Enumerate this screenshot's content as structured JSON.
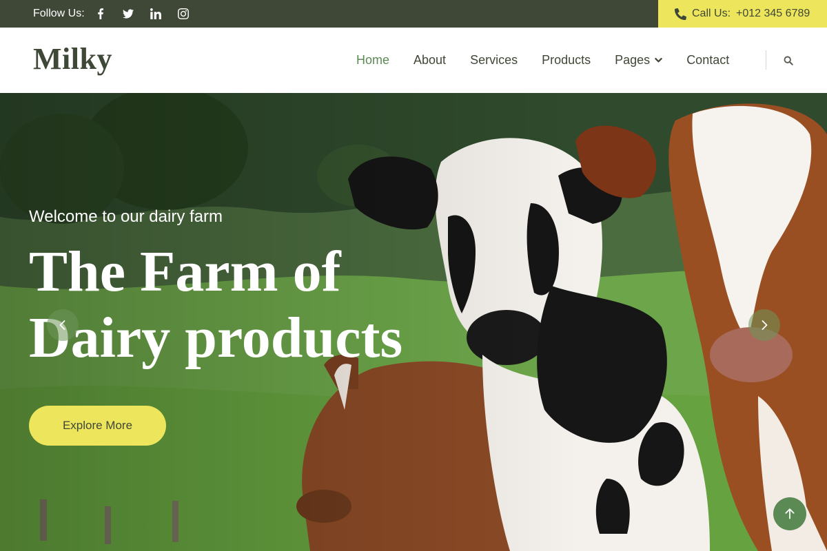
{
  "topbar": {
    "follow_label": "Follow Us:",
    "social_icons": [
      "facebook-icon",
      "twitter-icon",
      "linkedin-icon",
      "instagram-icon"
    ],
    "call_label": "Call Us:",
    "phone": "+012 345 6789",
    "background_color": "#3f4737",
    "call_background_color": "#ede55c"
  },
  "nav": {
    "brand": "Milky",
    "items": [
      {
        "label": "Home",
        "active": true
      },
      {
        "label": "About"
      },
      {
        "label": "Services"
      },
      {
        "label": "Products"
      },
      {
        "label": "Pages",
        "has_dropdown": true
      },
      {
        "label": "Contact"
      }
    ],
    "search_icon": "search-icon",
    "active_color": "#5b8a55"
  },
  "hero": {
    "subtitle": "Welcome to our dairy farm",
    "title_line1": "The Farm of",
    "title_line2": "Dairy products",
    "button": "Explore More",
    "prev_icon": "chevron-left-icon",
    "next_icon": "chevron-right-icon",
    "image": "cows-in-green-pasture"
  },
  "back_to_top_icon": "arrow-up-icon"
}
